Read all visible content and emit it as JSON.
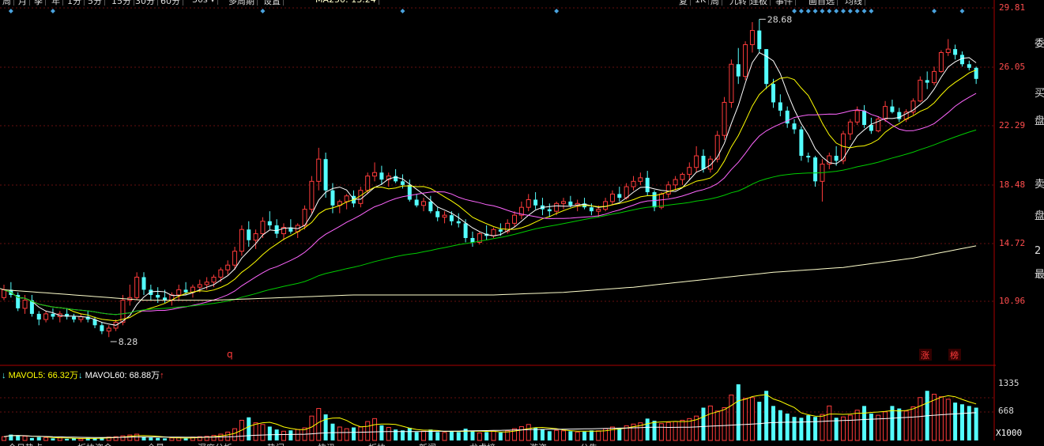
{
  "toolbar": {
    "period_buttons": [
      "周",
      "月",
      "季",
      "年",
      "1分",
      "5分",
      "15分",
      "30分",
      "60分"
    ],
    "multi_period": "多周期",
    "settings": "设置",
    "ma_label": "MA250: 13.24",
    "right_buttons": [
      "复",
      "1K",
      "周",
      "九转",
      "连板",
      "事件",
      "画自选",
      "均线"
    ]
  },
  "price_axis": {
    "ticks": [
      "29.81",
      "26.05",
      "22.29",
      "18.48",
      "14.72",
      "10.96"
    ]
  },
  "volume_axis": {
    "ticks": [
      "1335",
      "668"
    ],
    "scale": "X1000"
  },
  "volume_legend": {
    "mavol5": "MAVOL5: 66.32万",
    "mavol60": "MAVOL60: 68.88万"
  },
  "annotations": {
    "high": "28.68",
    "low": "8.28",
    "zhang": "涨",
    "bang": "榜",
    "q_marker": "q"
  },
  "right_panel": [
    "委",
    "买",
    "盘",
    "卖",
    "盘",
    "2",
    "最"
  ],
  "bottom_tabs": [
    "今日热点",
    "板块资金",
    "全景",
    "深度分析",
    "热门",
    "快讯",
    "板块",
    "新闻",
    "龙虎榜",
    "游资",
    "公告"
  ],
  "colors": {
    "up": "#ff3b3b",
    "down": "#54ffff",
    "ma5": "#ffffff",
    "ma10": "#ffff00",
    "ma20": "#ff66ff",
    "ma60": "#00cc00",
    "ma250": "#ffffcc",
    "grid": "#661111",
    "axis": "#aa0000"
  },
  "chart_data": {
    "type": "candlestick",
    "y_scale": "log",
    "ylim": [
      8.28,
      29.81
    ],
    "candles": [
      [
        11.1,
        11.6,
        11.0,
        11.4
      ],
      [
        11.4,
        11.7,
        11.1,
        11.2
      ],
      [
        11.2,
        11.3,
        10.6,
        10.7
      ],
      [
        10.7,
        11.2,
        10.5,
        11.0
      ],
      [
        11.0,
        11.2,
        10.4,
        10.5
      ],
      [
        10.5,
        10.6,
        10.1,
        10.3
      ],
      [
        10.3,
        10.6,
        10.2,
        10.5
      ],
      [
        10.5,
        10.7,
        10.3,
        10.4
      ],
      [
        10.4,
        10.6,
        10.2,
        10.5
      ],
      [
        10.5,
        10.7,
        10.3,
        10.4
      ],
      [
        10.4,
        10.5,
        10.2,
        10.3
      ],
      [
        10.3,
        10.5,
        10.2,
        10.4
      ],
      [
        10.4,
        10.6,
        10.2,
        10.3
      ],
      [
        10.3,
        10.4,
        10.0,
        10.1
      ],
      [
        10.1,
        10.2,
        9.8,
        9.9
      ],
      [
        9.9,
        10.1,
        9.7,
        10.0
      ],
      [
        10.0,
        10.3,
        9.9,
        10.2
      ],
      [
        10.2,
        11.2,
        10.1,
        11.0
      ],
      [
        11.0,
        11.6,
        10.8,
        11.1
      ],
      [
        11.1,
        12.1,
        11.0,
        11.9
      ],
      [
        11.9,
        12.1,
        11.2,
        11.4
      ],
      [
        11.4,
        11.6,
        11.0,
        11.2
      ],
      [
        11.2,
        11.5,
        10.9,
        11.1
      ],
      [
        11.1,
        11.4,
        10.9,
        11.0
      ],
      [
        11.0,
        11.3,
        10.8,
        11.2
      ],
      [
        11.2,
        11.6,
        11.0,
        11.4
      ],
      [
        11.4,
        11.7,
        11.2,
        11.3
      ],
      [
        11.3,
        11.6,
        11.1,
        11.5
      ],
      [
        11.5,
        11.8,
        11.3,
        11.6
      ],
      [
        11.6,
        11.9,
        11.4,
        11.7
      ],
      [
        11.7,
        12.0,
        11.5,
        11.9
      ],
      [
        11.9,
        12.3,
        11.7,
        12.2
      ],
      [
        12.2,
        12.6,
        12.0,
        12.4
      ],
      [
        12.4,
        13.2,
        12.2,
        13.0
      ],
      [
        13.0,
        14.2,
        12.8,
        14.0
      ],
      [
        14.0,
        14.4,
        13.2,
        13.5
      ],
      [
        13.5,
        14.0,
        13.1,
        13.8
      ],
      [
        13.8,
        14.6,
        13.6,
        14.4
      ],
      [
        14.4,
        14.9,
        14.0,
        14.2
      ],
      [
        14.2,
        14.5,
        13.6,
        13.8
      ],
      [
        13.8,
        14.3,
        13.5,
        14.1
      ],
      [
        14.1,
        14.5,
        13.8,
        13.9
      ],
      [
        13.9,
        14.3,
        13.6,
        14.2
      ],
      [
        14.2,
        15.2,
        14.0,
        15.0
      ],
      [
        15.0,
        16.8,
        14.8,
        16.5
      ],
      [
        16.5,
        18.5,
        16.0,
        17.8
      ],
      [
        17.8,
        18.2,
        15.6,
        16.0
      ],
      [
        16.0,
        16.4,
        14.8,
        15.2
      ],
      [
        15.2,
        15.5,
        14.8,
        15.4
      ],
      [
        15.4,
        15.8,
        15.0,
        15.7
      ],
      [
        15.7,
        16.0,
        15.1,
        15.3
      ],
      [
        15.3,
        16.2,
        15.1,
        16.0
      ],
      [
        16.0,
        17.0,
        15.8,
        16.8
      ],
      [
        16.8,
        17.6,
        16.5,
        17.0
      ],
      [
        17.0,
        17.4,
        16.3,
        16.6
      ],
      [
        16.6,
        17.0,
        16.2,
        16.8
      ],
      [
        16.8,
        17.2,
        16.4,
        16.5
      ],
      [
        16.5,
        16.9,
        16.1,
        16.3
      ],
      [
        16.3,
        16.6,
        15.4,
        15.5
      ],
      [
        15.5,
        15.8,
        15.1,
        15.2
      ],
      [
        15.2,
        15.6,
        14.9,
        15.4
      ],
      [
        15.4,
        15.7,
        14.8,
        14.9
      ],
      [
        14.9,
        15.1,
        14.4,
        14.6
      ],
      [
        14.6,
        14.9,
        14.3,
        14.7
      ],
      [
        14.7,
        14.9,
        14.2,
        14.4
      ],
      [
        14.4,
        14.8,
        14.1,
        14.3
      ],
      [
        14.3,
        14.5,
        13.4,
        13.6
      ],
      [
        13.6,
        13.9,
        13.2,
        13.4
      ],
      [
        13.4,
        13.9,
        13.3,
        13.8
      ],
      [
        13.8,
        14.2,
        13.5,
        13.7
      ],
      [
        13.7,
        14.1,
        13.6,
        14.0
      ],
      [
        14.0,
        14.3,
        13.7,
        13.9
      ],
      [
        13.9,
        14.5,
        13.8,
        14.3
      ],
      [
        14.3,
        14.9,
        14.1,
        14.7
      ],
      [
        14.7,
        15.4,
        14.5,
        15.1
      ],
      [
        15.1,
        15.8,
        14.9,
        15.5
      ],
      [
        15.5,
        15.9,
        15.0,
        15.2
      ],
      [
        15.2,
        15.6,
        14.7,
        15.0
      ],
      [
        15.0,
        15.3,
        14.6,
        14.9
      ],
      [
        14.9,
        15.4,
        14.7,
        15.3
      ],
      [
        15.3,
        15.6,
        15.0,
        15.4
      ],
      [
        15.4,
        15.7,
        15.1,
        15.2
      ],
      [
        15.2,
        15.5,
        14.9,
        15.3
      ],
      [
        15.3,
        15.6,
        15.0,
        15.1
      ],
      [
        15.1,
        15.3,
        14.7,
        14.9
      ],
      [
        14.9,
        15.2,
        14.6,
        15.0
      ],
      [
        15.0,
        15.6,
        14.9,
        15.4
      ],
      [
        15.4,
        16.0,
        15.2,
        15.8
      ],
      [
        15.8,
        16.2,
        15.4,
        15.6
      ],
      [
        15.6,
        16.4,
        15.5,
        16.2
      ],
      [
        16.2,
        16.8,
        16.0,
        16.5
      ],
      [
        16.5,
        17.0,
        16.3,
        16.7
      ],
      [
        16.7,
        17.1,
        15.7,
        15.9
      ],
      [
        15.9,
        16.0,
        14.9,
        15.1
      ],
      [
        15.1,
        15.9,
        15.0,
        15.8
      ],
      [
        15.8,
        16.5,
        15.6,
        16.3
      ],
      [
        16.3,
        16.8,
        16.0,
        16.6
      ],
      [
        16.6,
        17.0,
        16.3,
        16.9
      ],
      [
        16.9,
        17.6,
        16.6,
        17.3
      ],
      [
        17.3,
        18.6,
        17.0,
        18.0
      ],
      [
        18.0,
        18.4,
        17.0,
        17.2
      ],
      [
        17.2,
        18.0,
        17.0,
        17.8
      ],
      [
        17.8,
        19.6,
        17.6,
        19.3
      ],
      [
        19.3,
        22.0,
        19.0,
        21.6
      ],
      [
        21.6,
        25.0,
        21.2,
        24.6
      ],
      [
        24.6,
        26.0,
        23.0,
        23.6
      ],
      [
        23.6,
        26.6,
        23.3,
        26.3
      ],
      [
        26.3,
        28.4,
        25.6,
        27.6
      ],
      [
        27.6,
        28.68,
        25.6,
        25.9
      ],
      [
        25.9,
        25.9,
        22.6,
        23.0
      ],
      [
        23.0,
        23.4,
        21.2,
        21.6
      ],
      [
        21.6,
        22.2,
        20.6,
        21.0
      ],
      [
        21.0,
        21.3,
        19.8,
        20.1
      ],
      [
        20.1,
        20.4,
        19.4,
        19.7
      ],
      [
        19.7,
        19.9,
        17.7,
        18.0
      ],
      [
        18.0,
        18.2,
        17.6,
        17.9
      ],
      [
        17.9,
        18.0,
        16.2,
        16.5
      ],
      [
        16.5,
        17.8,
        15.4,
        17.5
      ],
      [
        17.5,
        18.2,
        17.2,
        18.0
      ],
      [
        18.0,
        18.6,
        17.4,
        17.7
      ],
      [
        17.7,
        19.6,
        17.5,
        19.4
      ],
      [
        19.4,
        20.4,
        19.0,
        20.2
      ],
      [
        20.2,
        21.3,
        20.0,
        21.0
      ],
      [
        21.0,
        21.4,
        19.8,
        20.0
      ],
      [
        20.0,
        20.5,
        19.4,
        19.6
      ],
      [
        19.6,
        20.6,
        19.5,
        20.4
      ],
      [
        20.4,
        21.7,
        20.2,
        21.3
      ],
      [
        21.3,
        21.8,
        20.8,
        20.9
      ],
      [
        20.9,
        21.2,
        20.2,
        20.4
      ],
      [
        20.4,
        21.1,
        20.2,
        20.9
      ],
      [
        20.9,
        21.9,
        20.7,
        21.7
      ],
      [
        21.7,
        23.6,
        21.6,
        23.3
      ],
      [
        23.3,
        24.0,
        22.6,
        23.1
      ],
      [
        23.1,
        24.4,
        22.9,
        24.0
      ],
      [
        24.0,
        25.8,
        23.9,
        25.6
      ],
      [
        25.6,
        26.8,
        25.3,
        25.9
      ],
      [
        25.9,
        26.3,
        25.0,
        25.4
      ],
      [
        25.4,
        25.7,
        24.4,
        24.6
      ],
      [
        24.6,
        24.9,
        24.1,
        24.3
      ],
      [
        24.3,
        24.4,
        23.0,
        23.4
      ]
    ],
    "volume": [
      90,
      140,
      120,
      100,
      60,
      80,
      70,
      50,
      60,
      40,
      50,
      40,
      60,
      50,
      70,
      80,
      90,
      110,
      130,
      150,
      90,
      70,
      60,
      50,
      60,
      70,
      50,
      80,
      90,
      100,
      120,
      150,
      200,
      280,
      480,
      550,
      420,
      380,
      330,
      260,
      220,
      240,
      260,
      300,
      580,
      760,
      620,
      400,
      320,
      280,
      310,
      320,
      450,
      520,
      360,
      310,
      260,
      240,
      300,
      200,
      220,
      260,
      200,
      190,
      220,
      200,
      280,
      220,
      180,
      200,
      220,
      190,
      230,
      280,
      330,
      380,
      300,
      260,
      220,
      240,
      230,
      220,
      200,
      210,
      240,
      230,
      280,
      320,
      300,
      350,
      390,
      420,
      520,
      470,
      400,
      430,
      450,
      480,
      520,
      580,
      780,
      820,
      700,
      780,
      1080,
      1335,
      1000,
      1020,
      920,
      1180,
      820,
      720,
      640,
      560,
      540,
      600,
      560,
      620,
      820,
      540,
      560,
      600,
      720,
      820,
      640,
      600,
      680,
      820,
      760,
      700,
      800,
      1020,
      1180,
      1100,
      1040,
      980,
      900,
      860,
      820,
      780
    ],
    "ma250": [
      [
        0,
        11.4
      ],
      [
        10,
        11.2
      ],
      [
        20,
        11.0
      ],
      [
        30,
        11.0
      ],
      [
        40,
        11.1
      ],
      [
        50,
        11.2
      ],
      [
        60,
        11.2
      ],
      [
        70,
        11.2
      ],
      [
        80,
        11.3
      ],
      [
        90,
        11.5
      ],
      [
        100,
        11.8
      ],
      [
        110,
        12.1
      ],
      [
        120,
        12.3
      ],
      [
        130,
        12.7
      ],
      [
        139,
        13.24
      ]
    ]
  }
}
